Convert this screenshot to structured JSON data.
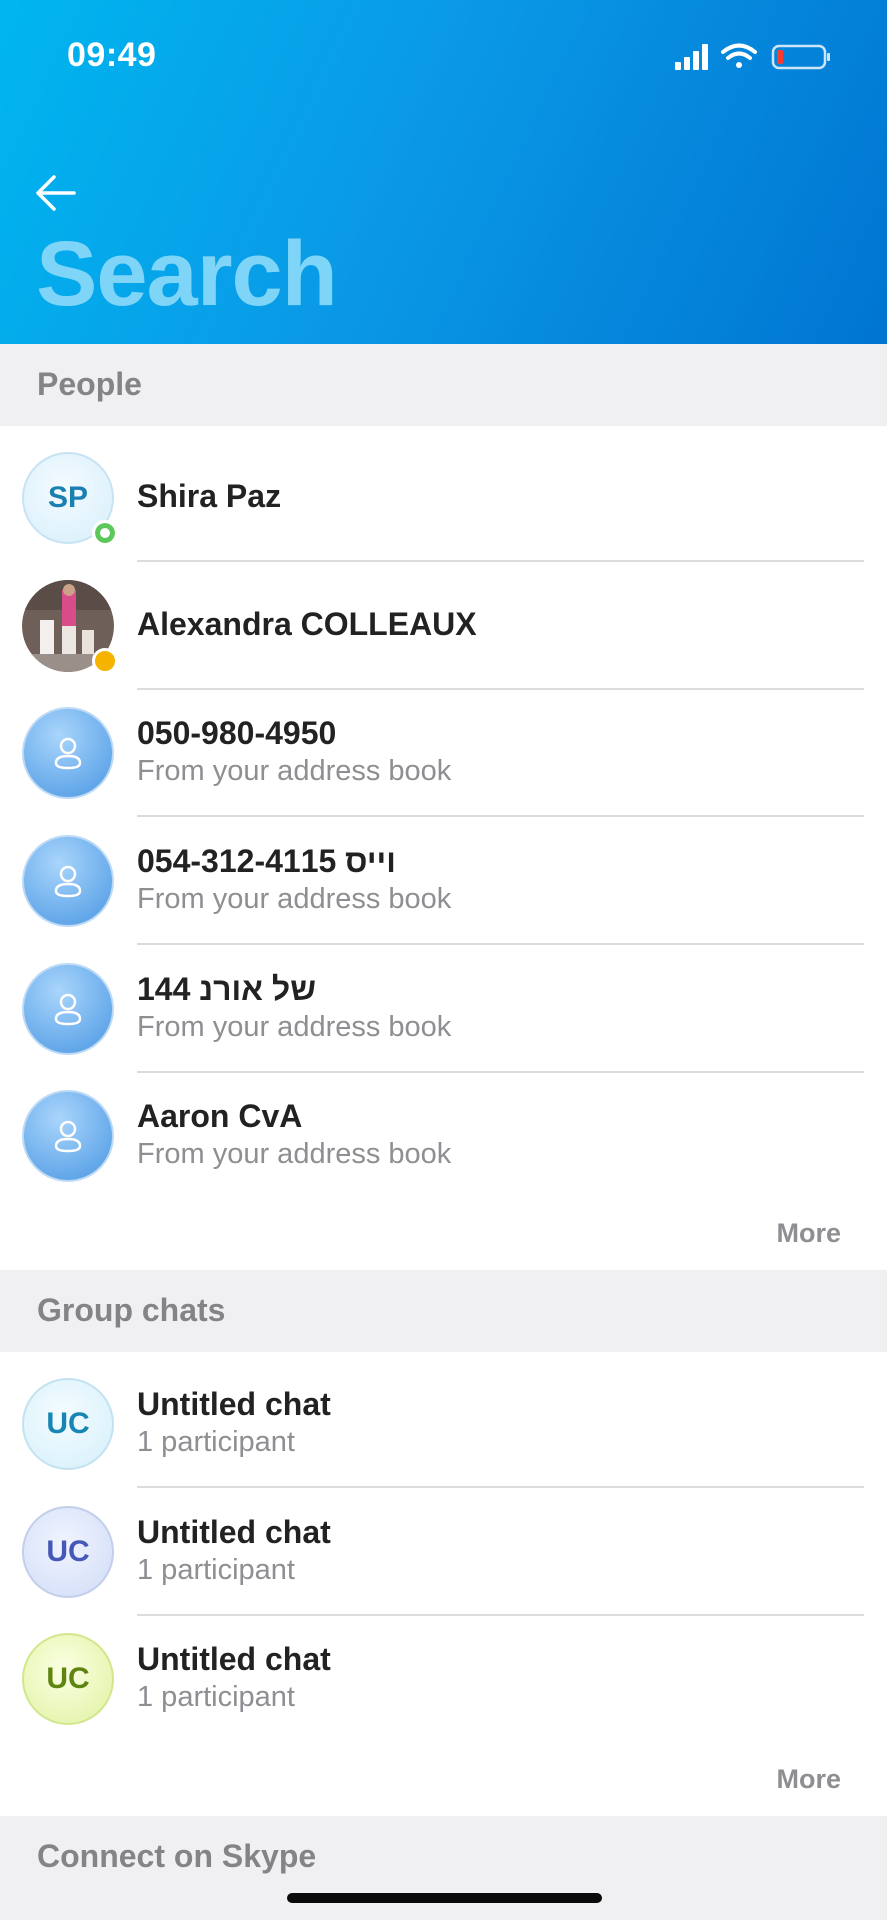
{
  "status_bar": {
    "time": "09:49"
  },
  "header": {
    "title": "Search"
  },
  "sections": {
    "people": "People",
    "group_chats": "Group chats",
    "connect": "Connect on Skype"
  },
  "people": [
    {
      "initials": "SP",
      "name": "Shira Paz",
      "subtitle": "",
      "presence": "online"
    },
    {
      "initials": "",
      "name": "Alexandra COLLEAUX",
      "subtitle": "",
      "presence": "away"
    },
    {
      "initials": "",
      "name": "050-980-4950",
      "subtitle": "From your address book"
    },
    {
      "initials": "",
      "name": "וייס 054-312-4115",
      "subtitle": "From your address book"
    },
    {
      "initials": "",
      "name": "144 של אורנ",
      "subtitle": "From your address book"
    },
    {
      "initials": "",
      "name": "Aaron CvA",
      "subtitle": "From your address book"
    }
  ],
  "group_chats": [
    {
      "initials": "UC",
      "name": "Untitled chat",
      "subtitle": "1 participant",
      "color": "#1786b4"
    },
    {
      "initials": "UC",
      "name": "Untitled chat",
      "subtitle": "1 participant",
      "color": "#4658b7"
    },
    {
      "initials": "UC",
      "name": "Untitled chat",
      "subtitle": "1 participant",
      "color": "#5f8511"
    }
  ],
  "more_label": "More",
  "colors": {
    "accent": "#0078d4",
    "presence_online": "#5cc85c",
    "presence_away": "#f4b400"
  }
}
